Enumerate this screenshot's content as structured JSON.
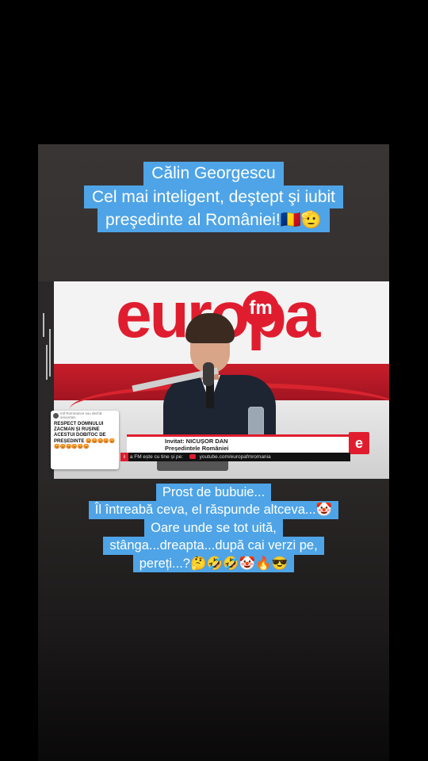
{
  "caption_top": [
    "Călin Georgescu",
    "Cel mai inteligent, deştept şi iubit",
    "preşedinte al României!🇷🇴🫡"
  ],
  "caption_bottom": [
    "Prost de bubuie...",
    "Îl întreabă ceva, el răspunde altceva...🤡",
    "Oare unde se tot uită,",
    "stânga...dreapta...după cai verzi pe,",
    "pereți...?🤔🤣🤣🤡🔥😎"
  ],
  "video": {
    "logo_text": "europa",
    "logo_badge": "fm",
    "lower_third_line1": "Invitat: NICUȘOR DAN",
    "lower_third_line2": "Președintele României",
    "lower_third_icon": "e",
    "ticker_text": "a FM  ește cu tine și pe:",
    "ticker_url": "youtube.com/europafmromania",
    "ticker_left_glyph": "i"
  },
  "comment": {
    "header": "Intl Rommance sou dechă anioorites",
    "body": "RESPECT DOMNULUI ZACMAN ȘI RUȘINE ACESTUI DOBITOC DE PREȘEDINTE 😡😡😡😡😡😡😡😡😡😡😡"
  },
  "colors": {
    "caption_bg": "#4ea4e6",
    "brand_red": "#e01d2f",
    "panel_bg": "#353131"
  }
}
